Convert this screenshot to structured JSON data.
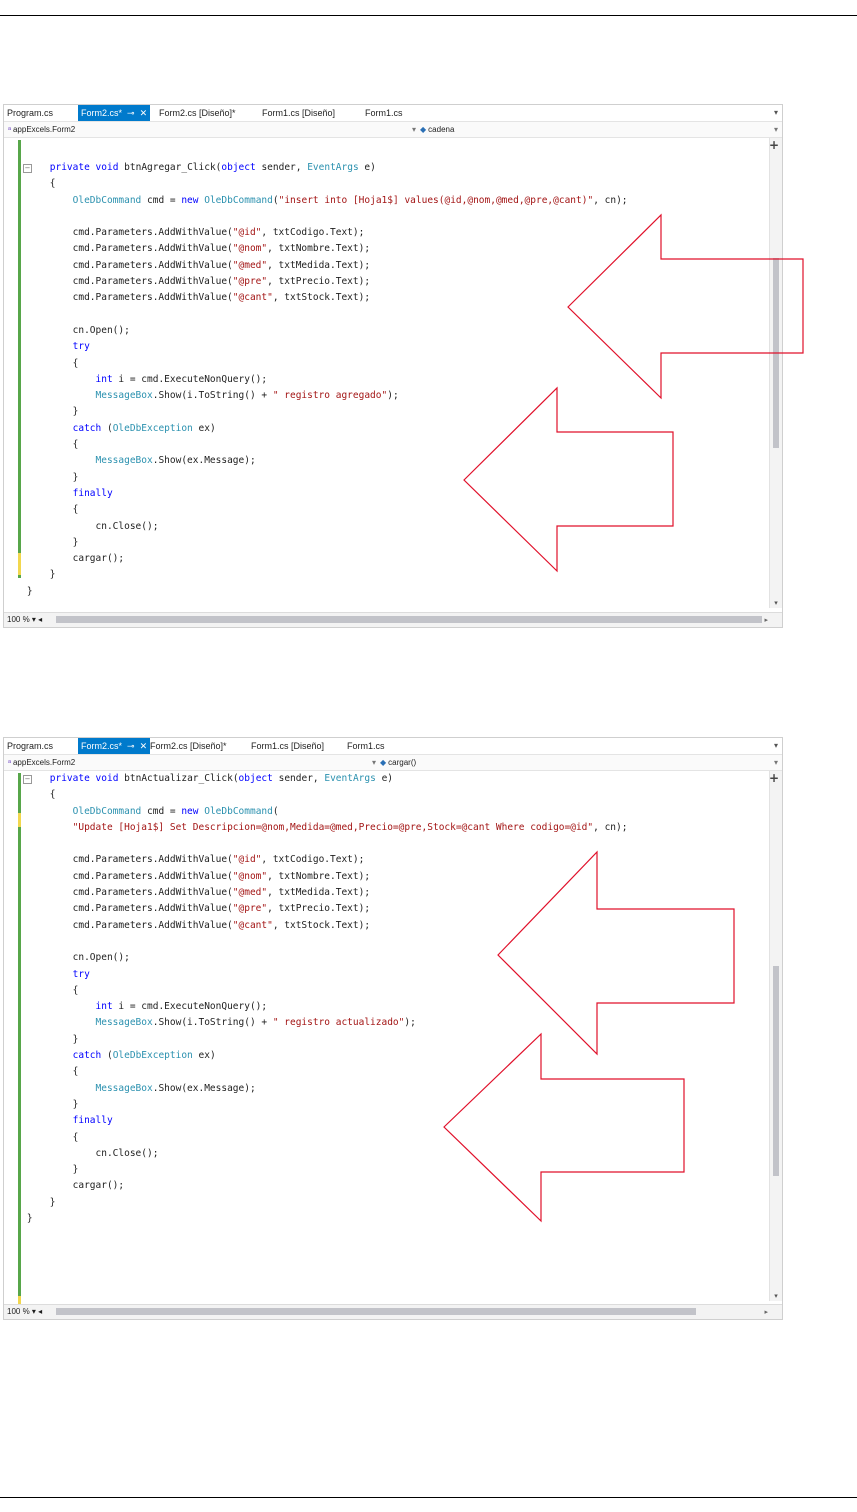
{
  "editors": [
    {
      "tabs": [
        {
          "label": "Program.cs",
          "active": false
        },
        {
          "label": "Form2.cs*",
          "active": true,
          "pin": "⊸",
          "close": "✕"
        },
        {
          "label": "Form2.cs [Diseño]*",
          "active": false
        },
        {
          "label": "Form1.cs [Diseño]",
          "active": false
        },
        {
          "label": "Form1.cs",
          "active": false
        }
      ],
      "project": "appExcels.Form2",
      "member": "cadena",
      "zoom": "100 %",
      "code": [
        "        private void btnAgregar_Click(object sender, EventArgs e)",
        "        {",
        "            OleDbCommand cmd = new OleDbCommand(\"insert into [Hoja1$] values(@id,@nom,@med,@pre,@cant)\", cn);",
        "",
        "            cmd.Parameters.AddWithValue(\"@id\", txtCodigo.Text);",
        "            cmd.Parameters.AddWithValue(\"@nom\", txtNombre.Text);",
        "            cmd.Parameters.AddWithValue(\"@med\", txtMedida.Text);",
        "            cmd.Parameters.AddWithValue(\"@pre\", txtPrecio.Text);",
        "            cmd.Parameters.AddWithValue(\"@cant\", txtStock.Text);",
        "",
        "            cn.Open();",
        "            try",
        "            {",
        "                int i = cmd.ExecuteNonQuery();",
        "                MessageBox.Show(i.ToString() + \" registro agregado\");",
        "            }",
        "            catch (OleDbException ex)",
        "            {",
        "                MessageBox.Show(ex.Message);",
        "            }",
        "            finally",
        "            {",
        "                cn.Close();",
        "            }",
        "            cargar();",
        "        }",
        "    }"
      ]
    },
    {
      "tabs": [
        {
          "label": "Program.cs",
          "active": false
        },
        {
          "label": "Form2.cs*",
          "active": true,
          "pin": "⊸",
          "close": "✕"
        },
        {
          "label": "Form2.cs [Diseño]*",
          "active": false
        },
        {
          "label": "Form1.cs [Diseño]",
          "active": false
        },
        {
          "label": "Form1.cs",
          "active": false
        }
      ],
      "project": "appExcels.Form2",
      "member": "cargar()",
      "zoom": "100 %",
      "code": [
        "        private void btnActualizar_Click(object sender, EventArgs e)",
        "        {",
        "            OleDbCommand cmd = new OleDbCommand(",
        "            \"Update [Hoja1$] Set Descripcion=@nom,Medida=@med,Precio=@pre,Stock=@cant Where codigo=@id\", cn);",
        "",
        "            cmd.Parameters.AddWithValue(\"@id\", txtCodigo.Text);",
        "            cmd.Parameters.AddWithValue(\"@nom\", txtNombre.Text);",
        "            cmd.Parameters.AddWithValue(\"@med\", txtMedida.Text);",
        "            cmd.Parameters.AddWithValue(\"@pre\", txtPrecio.Text);",
        "            cmd.Parameters.AddWithValue(\"@cant\", txtStock.Text);",
        "",
        "            cn.Open();",
        "            try",
        "            {",
        "                int i = cmd.ExecuteNonQuery();",
        "                MessageBox.Show(i.ToString() + \" registro actualizado\");",
        "            }",
        "            catch (OleDbException ex)",
        "            {",
        "                MessageBox.Show(ex.Message);",
        "            }",
        "            finally",
        "            {",
        "                cn.Close();",
        "            }",
        "            cargar();",
        "        }",
        "    }"
      ]
    }
  ],
  "colors": {
    "keyword": "#0000ff",
    "type": "#2b91af",
    "string": "#a31515",
    "active_tab": "#007acc",
    "change_bar": "#57a64a",
    "unsaved_bar": "#f2d74e",
    "annotation_arrow": "#e0102a"
  },
  "icons": {
    "project": "csharp-class-icon",
    "member": "field-member-icon",
    "dropdown": "chevron-down-icon",
    "split": "split-view-plus-icon"
  }
}
